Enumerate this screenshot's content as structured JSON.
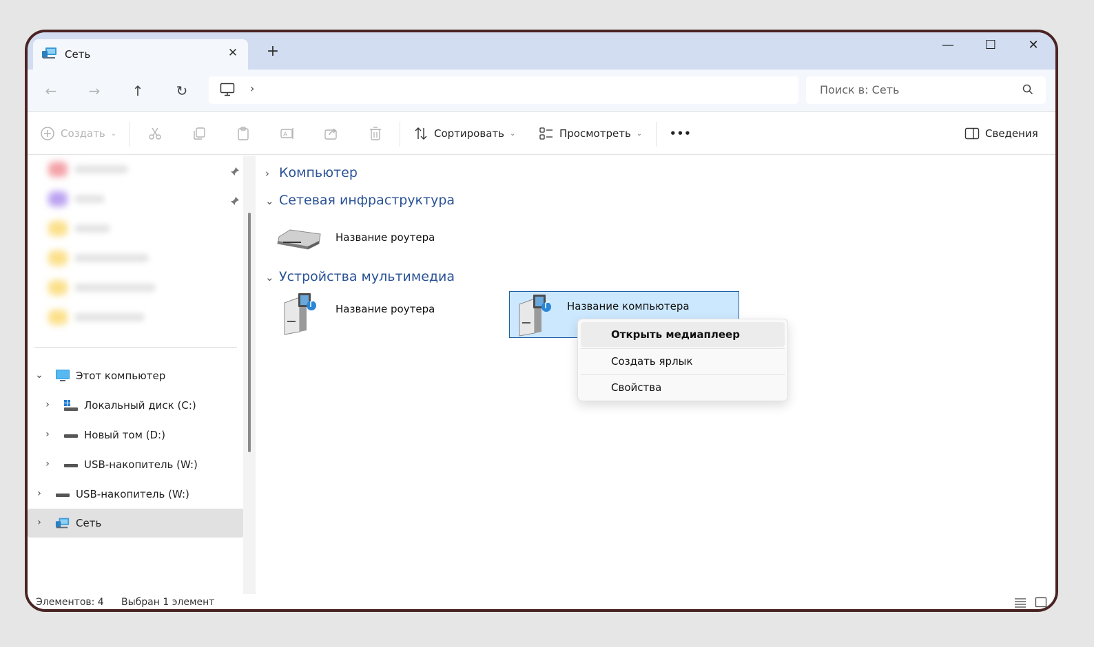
{
  "window": {
    "tab_title": "Сеть",
    "tab_close": "✕",
    "new_tab": "+",
    "controls": {
      "minimize": "—",
      "maximize": "☐",
      "close": "✕"
    }
  },
  "navigation": {
    "back": "←",
    "forward": "→",
    "up": "↑",
    "refresh": "↻",
    "breadcrumb_separator": "›",
    "search_placeholder": "Поиск в: Сеть"
  },
  "toolbar": {
    "create": "Создать",
    "sort": "Сортировать",
    "view": "Просмотреть",
    "more": "•••",
    "details": "Сведения"
  },
  "sidebar": {
    "tree": [
      {
        "label": "Этот компьютер",
        "expanded": true,
        "icon": "monitor-icon"
      },
      {
        "label": "Локальный диск (C:)",
        "icon": "windows-drive-icon"
      },
      {
        "label": "Новый том (D:)",
        "icon": "drive-icon"
      },
      {
        "label": "USB-накопитель (W:)",
        "icon": "drive-icon"
      },
      {
        "label": "USB-накопитель (W:)",
        "icon": "drive-icon"
      },
      {
        "label": "Сеть",
        "selected": true,
        "icon": "network-icon"
      }
    ]
  },
  "content": {
    "groups": [
      {
        "label": "Компьютер",
        "expanded": false
      },
      {
        "label": "Сетевая инфраструктура",
        "expanded": true
      },
      {
        "label": "Устройства мультимедиа",
        "expanded": true
      }
    ],
    "items": [
      {
        "label": "Название роутера",
        "icon": "router-icon"
      },
      {
        "label": "Название роутера",
        "icon": "media-device-icon"
      },
      {
        "label": "Название компьютера",
        "icon": "media-device-icon",
        "selected": true
      }
    ]
  },
  "context_menu": {
    "items": [
      {
        "label": "Открыть медиаплеер",
        "default": true
      },
      {
        "label": "Создать ярлык"
      },
      {
        "label": "Свойства"
      }
    ]
  },
  "status_bar": {
    "count": "Элементов: 4",
    "selection": "Выбран 1 элемент"
  },
  "colors": {
    "title_bar": "#d2ddf1",
    "group_header": "#2a5296",
    "selection_fill": "#cce8ff",
    "selection_border": "#1d5fa4",
    "frame": "#4a2424"
  }
}
